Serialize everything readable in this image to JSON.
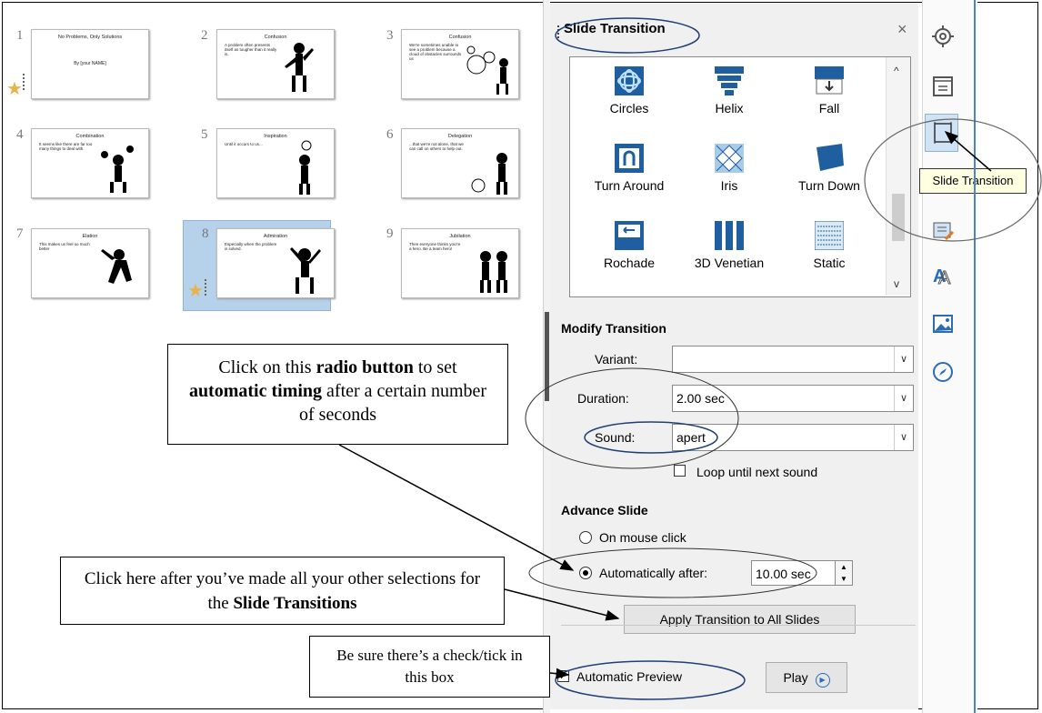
{
  "slides": [
    {
      "num": "1",
      "title": "No Problems, Only Solutions",
      "subtitle": "By [your NAME]",
      "bullets": ""
    },
    {
      "num": "2",
      "title": "Confusion",
      "subtitle": "",
      "bullets": "A problem often presents itself as tougher than it really is."
    },
    {
      "num": "3",
      "title": "Confusion",
      "subtitle": "",
      "bullets": "We're sometimes unable to see a problem because a cloud of obstacles surrounds us"
    },
    {
      "num": "4",
      "title": "Combination",
      "subtitle": "",
      "bullets": "It seems like there are far too many things to deal with."
    },
    {
      "num": "5",
      "title": "Inspiration",
      "subtitle": "",
      "bullets": "Until it occurs to us..."
    },
    {
      "num": "6",
      "title": "Delegation",
      "subtitle": "",
      "bullets": "...that we're not alone, that we can call on others to help out."
    },
    {
      "num": "7",
      "title": "Elation",
      "subtitle": "",
      "bullets": "This makes us feel so much better"
    },
    {
      "num": "8",
      "title": "Admiration",
      "subtitle": "",
      "bullets": "Especially when the problem is solved."
    },
    {
      "num": "9",
      "title": "Jubilation",
      "subtitle": "",
      "bullets": "Then everyone thinks you're a hero. Be a team hero!"
    }
  ],
  "sidebar": {
    "title": "Slide Transition",
    "close": "×",
    "transitions": [
      {
        "label": "Circles",
        "icon": "circles-icon"
      },
      {
        "label": "Helix",
        "icon": "helix-icon"
      },
      {
        "label": "Fall",
        "icon": "fall-icon"
      },
      {
        "label": "Turn Around",
        "icon": "turn-around-icon"
      },
      {
        "label": "Iris",
        "icon": "iris-icon"
      },
      {
        "label": "Turn Down",
        "icon": "turn-down-icon"
      },
      {
        "label": "Rochade",
        "icon": "rochade-icon"
      },
      {
        "label": "3D Venetian",
        "icon": "3d-venetian-icon"
      },
      {
        "label": "Static",
        "icon": "static-icon"
      }
    ],
    "modify": {
      "heading": "Modify Transition",
      "variant_label": "Variant:",
      "variant_value": "",
      "duration_label": "Duration:",
      "duration_value": "2.00 sec",
      "sound_label": "Sound:",
      "sound_value": "apert",
      "loop_label": "Loop until next sound",
      "loop_checked": false
    },
    "advance": {
      "heading": "Advance Slide",
      "on_click_label": "On mouse click",
      "auto_label": "Automatically after:",
      "auto_value": "10.00 sec",
      "selected": "automatically"
    },
    "apply_all_label": "Apply Transition to All Slides",
    "auto_preview_label": "Automatic Preview",
    "auto_preview_checked": true,
    "play_label": "Play"
  },
  "deck": {
    "icons": [
      "properties-icon",
      "sidebar-toggle-icon",
      "slide-transition-icon",
      "animation-icon",
      "styles-icon",
      "gallery-icon",
      "navigator-icon"
    ],
    "tooltip": "Slide Transition"
  },
  "callouts": {
    "radio": {
      "pre": "Click on this ",
      "b1": "radio button",
      "mid": " to set ",
      "b2": "automatic timing",
      "post": " after a certain number of seconds"
    },
    "apply": {
      "pre": "Click here after you’ve made all your other selections for the ",
      "b1": "Slide Transitions"
    },
    "preview": {
      "text": "Be sure there’s a check/tick in this box"
    }
  },
  "colors": {
    "panel": "#f0f0f0",
    "selected_slide": "#b6d1ea",
    "accent": "#2b6cb3",
    "callout_ellipse": "#1f3f77"
  }
}
